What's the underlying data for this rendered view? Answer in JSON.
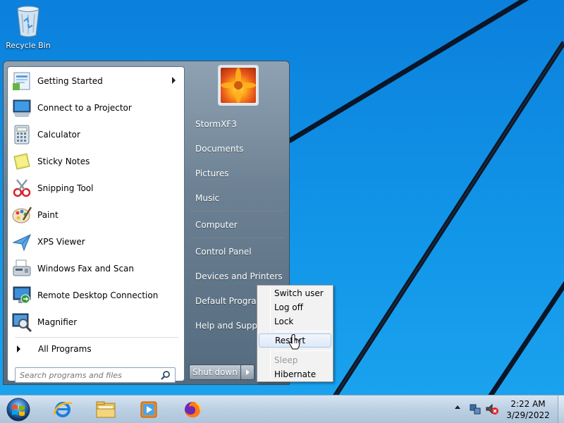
{
  "desktop": {
    "icons": [
      {
        "label": "Recycle Bin",
        "icon": "recycle-bin-icon"
      }
    ]
  },
  "start_menu": {
    "programs": [
      {
        "label": "Getting Started",
        "icon": "getting-started-icon",
        "has_submenu": true
      },
      {
        "label": "Connect to a Projector",
        "icon": "projector-icon"
      },
      {
        "label": "Calculator",
        "icon": "calculator-icon"
      },
      {
        "label": "Sticky Notes",
        "icon": "sticky-notes-icon"
      },
      {
        "label": "Snipping Tool",
        "icon": "scissors-icon"
      },
      {
        "label": "Paint",
        "icon": "paint-palette-icon"
      },
      {
        "label": "XPS Viewer",
        "icon": "xps-viewer-icon"
      },
      {
        "label": "Windows Fax and Scan",
        "icon": "fax-icon"
      },
      {
        "label": "Remote Desktop Connection",
        "icon": "remote-desktop-icon"
      },
      {
        "label": "Magnifier",
        "icon": "magnifier-icon"
      }
    ],
    "all_programs": "All Programs",
    "search_placeholder": "Search programs and files",
    "right_items": [
      {
        "label": "StormXF3"
      },
      {
        "label": "Documents"
      },
      {
        "label": "Pictures"
      },
      {
        "label": "Music"
      },
      {
        "label": "Computer"
      },
      {
        "label": "Control Panel"
      },
      {
        "label": "Devices and Printers"
      },
      {
        "label": "Default Programs"
      },
      {
        "label": "Help and Support"
      }
    ],
    "shutdown_label": "Shut down"
  },
  "power_menu": {
    "items": [
      {
        "label": "Switch user",
        "state": "normal"
      },
      {
        "label": "Log off",
        "state": "normal"
      },
      {
        "label": "Lock",
        "state": "normal"
      },
      {
        "label": "Restart",
        "state": "hover"
      },
      {
        "label": "Sleep",
        "state": "disabled"
      },
      {
        "label": "Hibernate",
        "state": "normal"
      }
    ]
  },
  "taskbar": {
    "pinned": [
      "internet-explorer-icon",
      "file-explorer-icon",
      "media-player-icon",
      "firefox-icon"
    ],
    "tray_icons": [
      "network-icon",
      "volume-muted-icon"
    ],
    "clock": {
      "time": "2:22 AM",
      "date": "3/29/2022"
    }
  },
  "colors": {
    "wallpaper": "#0a78d4",
    "taskbar": "#bcd0e3",
    "menu_highlight": "#dde9f8"
  }
}
